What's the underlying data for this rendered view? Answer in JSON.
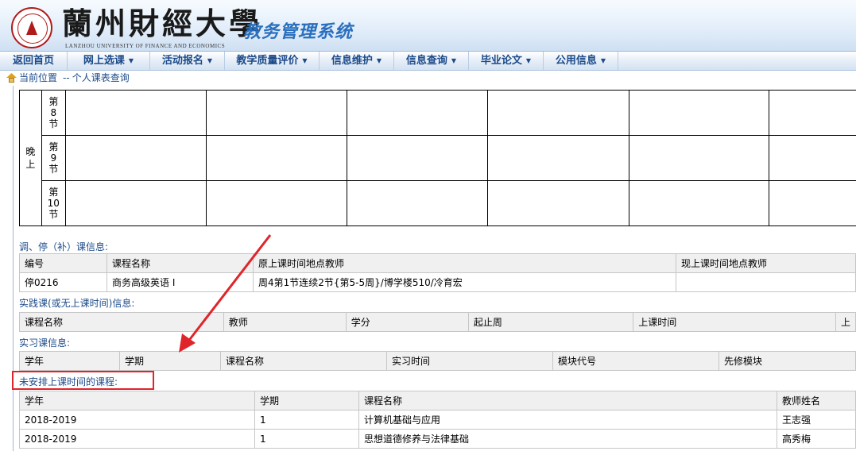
{
  "header": {
    "university": "蘭州財經大學",
    "university_en": "LANZHOU UNIVERSITY OF FINANCE AND ECONOMICS",
    "system_name": "教务管理系统"
  },
  "nav": {
    "items": [
      {
        "label": "返回首页",
        "dropdown": false
      },
      {
        "label": "网上选课",
        "dropdown": true
      },
      {
        "label": "活动报名",
        "dropdown": true
      },
      {
        "label": "教学质量评价",
        "dropdown": true
      },
      {
        "label": "信息维护",
        "dropdown": true
      },
      {
        "label": "信息查询",
        "dropdown": true
      },
      {
        "label": "毕业论文",
        "dropdown": true
      },
      {
        "label": "公用信息",
        "dropdown": true
      }
    ],
    "caret": "▼"
  },
  "breadcrumb": {
    "label": "当前位置",
    "separator": "--",
    "page": "个人课表查询"
  },
  "timetable": {
    "evening_label": "晚\n上",
    "periods": [
      "第\n8\n节",
      "第\n9\n节",
      "第\n10\n节"
    ]
  },
  "adjust_section": {
    "title": "调、停（补）课信息:",
    "headers": [
      "编号",
      "课程名称",
      "原上课时间地点教师",
      "现上课时间地点教师"
    ],
    "rows": [
      [
        "停0216",
        "商务高级英语 I",
        "周4第1节连续2节{第5-5周}/博学楼510/冷育宏",
        ""
      ]
    ]
  },
  "practice_section": {
    "title": "实践课(或无上课时间)信息:",
    "headers": [
      "课程名称",
      "教师",
      "学分",
      "起止周",
      "上课时间",
      "上"
    ]
  },
  "internship_section": {
    "title": "实习课信息:",
    "headers": [
      "学年",
      "学期",
      "课程名称",
      "实习时间",
      "模块代号",
      "先修模块"
    ]
  },
  "unscheduled_section": {
    "title": "未安排上课时间的课程:",
    "headers": [
      "学年",
      "学期",
      "课程名称",
      "教师姓名"
    ],
    "rows": [
      [
        "2018-2019",
        "1",
        "计算机基础与应用",
        "王志强"
      ],
      [
        "2018-2019",
        "1",
        "思想道德修养与法律基础",
        "高秀梅"
      ]
    ]
  },
  "colors": {
    "accent": "#1b4a8a",
    "system_title": "#2a6fbd",
    "annotation_red": "#e0242b"
  }
}
